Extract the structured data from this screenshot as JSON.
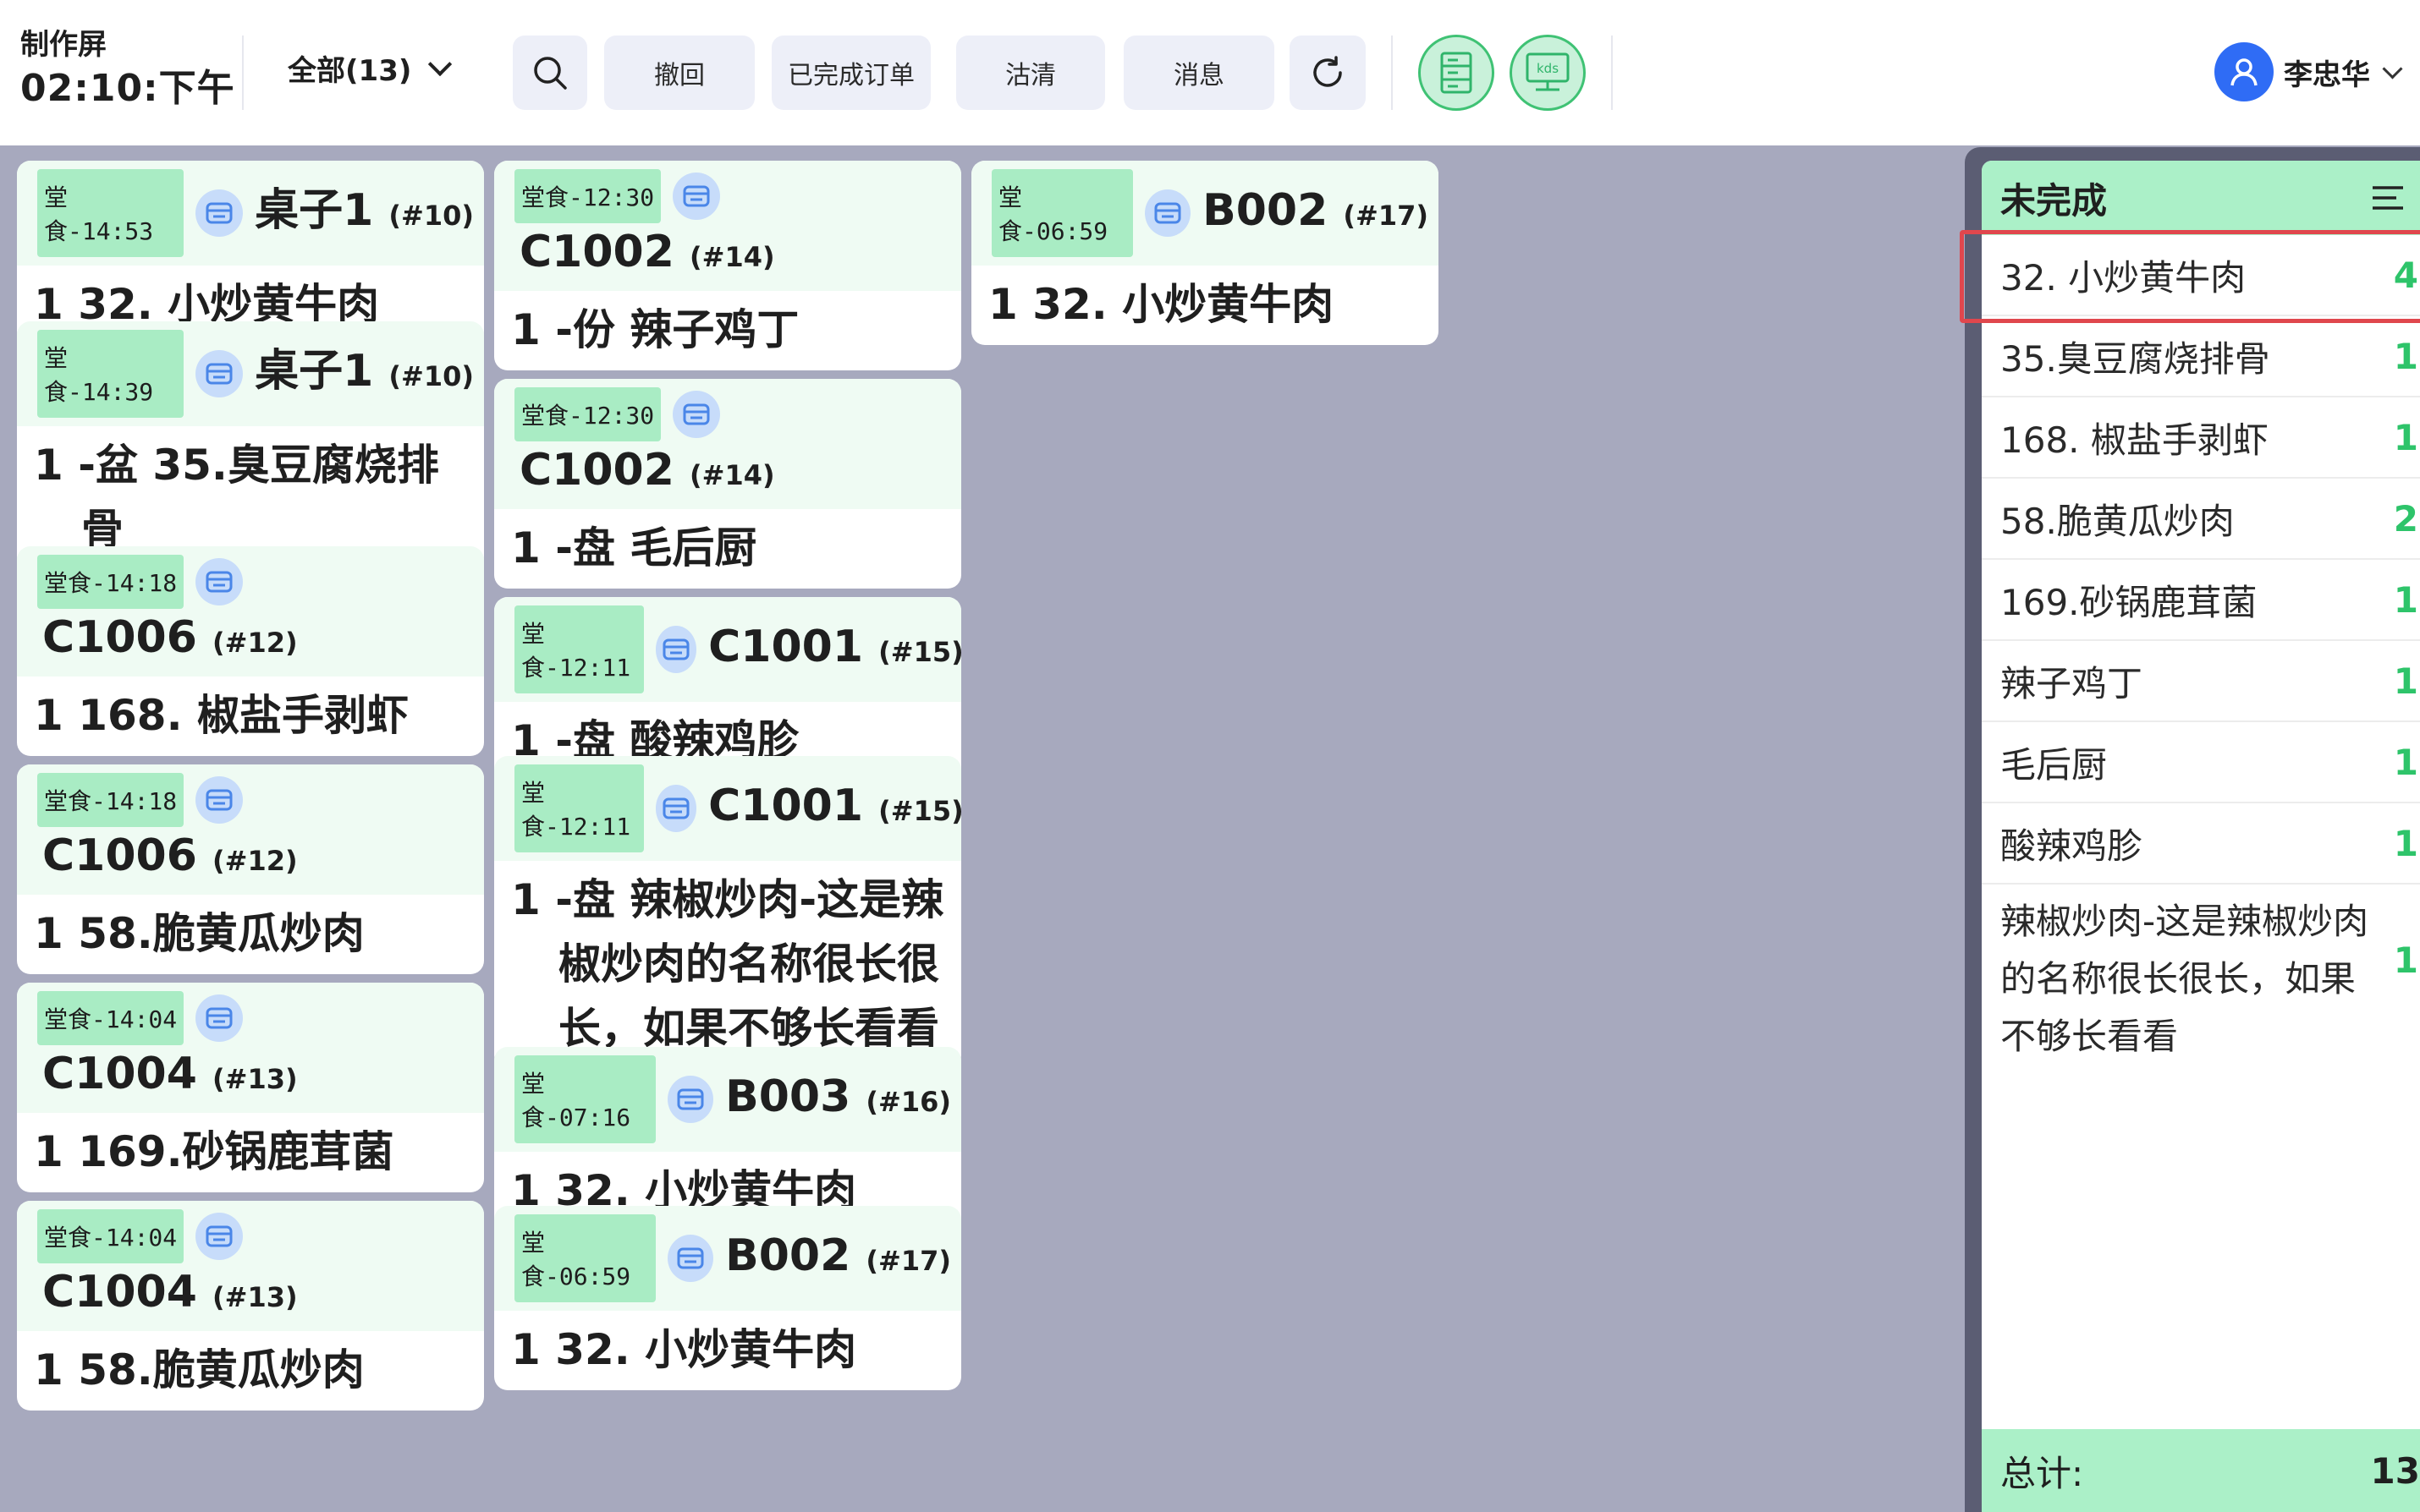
{
  "header": {
    "screen_name": "制作屏",
    "time": "02:10:下午",
    "filter_label": "全部(13)",
    "buttons": {
      "undo": "撤回",
      "completed": "已完成订单",
      "clear": "沽清",
      "messages": "消息"
    },
    "kds_icon_text": "kds",
    "user_name": "李忠华"
  },
  "colors": {
    "background": "#a7a9be",
    "accent_green": "#2ec46a",
    "badge_green": "#a9ecc4",
    "panel_header": "#abf0c8",
    "highlight": "#e0474d"
  },
  "orders": [
    {
      "badge": "堂食-14:53",
      "table": "桌子1",
      "num": "(#10)",
      "item": "1 32. 小炒黄牛肉"
    },
    {
      "badge": "堂食-14:39",
      "table": "桌子1",
      "num": "(#10)",
      "item": "1 -盆 35.臭豆腐烧排骨"
    },
    {
      "badge": "堂食-14:18",
      "table": "C1006",
      "num": "(#12)",
      "item": "1 168. 椒盐手剥虾"
    },
    {
      "badge": "堂食-14:18",
      "table": "C1006",
      "num": "(#12)",
      "item": "1 58.脆黄瓜炒肉"
    },
    {
      "badge": "堂食-14:04",
      "table": "C1004",
      "num": "(#13)",
      "item": "1 169.砂锅鹿茸菌"
    },
    {
      "badge": "堂食-14:04",
      "table": "C1004",
      "num": "(#13)",
      "item": "1 58.脆黄瓜炒肉"
    },
    {
      "badge": "堂食-12:30",
      "table": "C1002",
      "num": "(#14)",
      "item": "1 -份 辣子鸡丁"
    },
    {
      "badge": "堂食-12:30",
      "table": "C1002",
      "num": "(#14)",
      "item": "1 -盘 毛后厨"
    },
    {
      "badge": "堂食-12:11",
      "table": "C1001",
      "num": "(#15)",
      "item": "1 -盘 酸辣鸡胗"
    },
    {
      "badge": "堂食-12:11",
      "table": "C1001",
      "num": "(#15)",
      "item": "1 -盘 辣椒炒肉-这是辣椒炒肉的名称很长很长，如果不够长看看"
    },
    {
      "badge": "堂食-07:16",
      "table": "B003",
      "num": "(#16)",
      "item": "1 32. 小炒黄牛肉"
    },
    {
      "badge": "堂食-06:59",
      "table": "B002",
      "num": "(#17)",
      "item": "1 32. 小炒黄牛肉"
    },
    {
      "badge": "堂食-06:59",
      "table": "B002",
      "num": "(#17)",
      "item": "1 32. 小炒黄牛肉"
    }
  ],
  "panel": {
    "title": "未完成",
    "items": [
      {
        "name": "32. 小炒黄牛肉",
        "count": "4"
      },
      {
        "name": "35.臭豆腐烧排骨",
        "count": "1"
      },
      {
        "name": "168. 椒盐手剥虾",
        "count": "1"
      },
      {
        "name": "58.脆黄瓜炒肉",
        "count": "2"
      },
      {
        "name": "169.砂锅鹿茸菌",
        "count": "1"
      },
      {
        "name": "辣子鸡丁",
        "count": "1"
      },
      {
        "name": "毛后厨",
        "count": "1"
      },
      {
        "name": "酸辣鸡胗",
        "count": "1"
      },
      {
        "name": "辣椒炒肉-这是辣椒炒肉的名称很长很长，如果不够长看看",
        "count": "1"
      }
    ],
    "total_label": "总计:",
    "total_value": "13"
  }
}
